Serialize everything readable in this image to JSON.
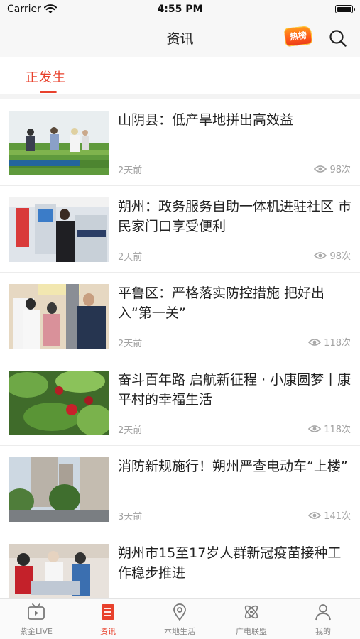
{
  "status_bar": {
    "carrier": "Carrier",
    "time": "4:55 PM"
  },
  "nav": {
    "title": "资讯",
    "hot_badge": "热榜"
  },
  "tabs": [
    {
      "label": "正发生",
      "active": true
    }
  ],
  "news": [
    {
      "title": "山阴县：低产旱地拼出高效益",
      "time": "2天前",
      "views": "98次"
    },
    {
      "title": "朔州：政务服务自助一体机进驻社区 市民家门口享受便利",
      "time": "2天前",
      "views": "98次"
    },
    {
      "title": "平鲁区：严格落实防控措施 把好出入“第一关”",
      "time": "2天前",
      "views": "118次"
    },
    {
      "title": "奋斗百年路 启航新征程 · 小康圆梦丨康平村的幸福生活",
      "time": "2天前",
      "views": "118次"
    },
    {
      "title": "消防新规施行！朔州严查电动车“上楼”",
      "time": "3天前",
      "views": "141次"
    },
    {
      "title": "朔州市15至17岁人群新冠疫苗接种工作稳步推进",
      "time": "",
      "views": ""
    }
  ],
  "bottom_tabs": [
    {
      "label": "紫金LIVE",
      "icon": "tv-icon",
      "active": false
    },
    {
      "label": "资讯",
      "icon": "news-list-icon",
      "active": true
    },
    {
      "label": "本地生活",
      "icon": "location-pin-icon",
      "active": false
    },
    {
      "label": "广电联盟",
      "icon": "atom-icon",
      "active": false
    },
    {
      "label": "我的",
      "icon": "user-icon",
      "active": false
    }
  ],
  "colors": {
    "accent": "#e8412c",
    "muted": "#a2a2a2"
  }
}
